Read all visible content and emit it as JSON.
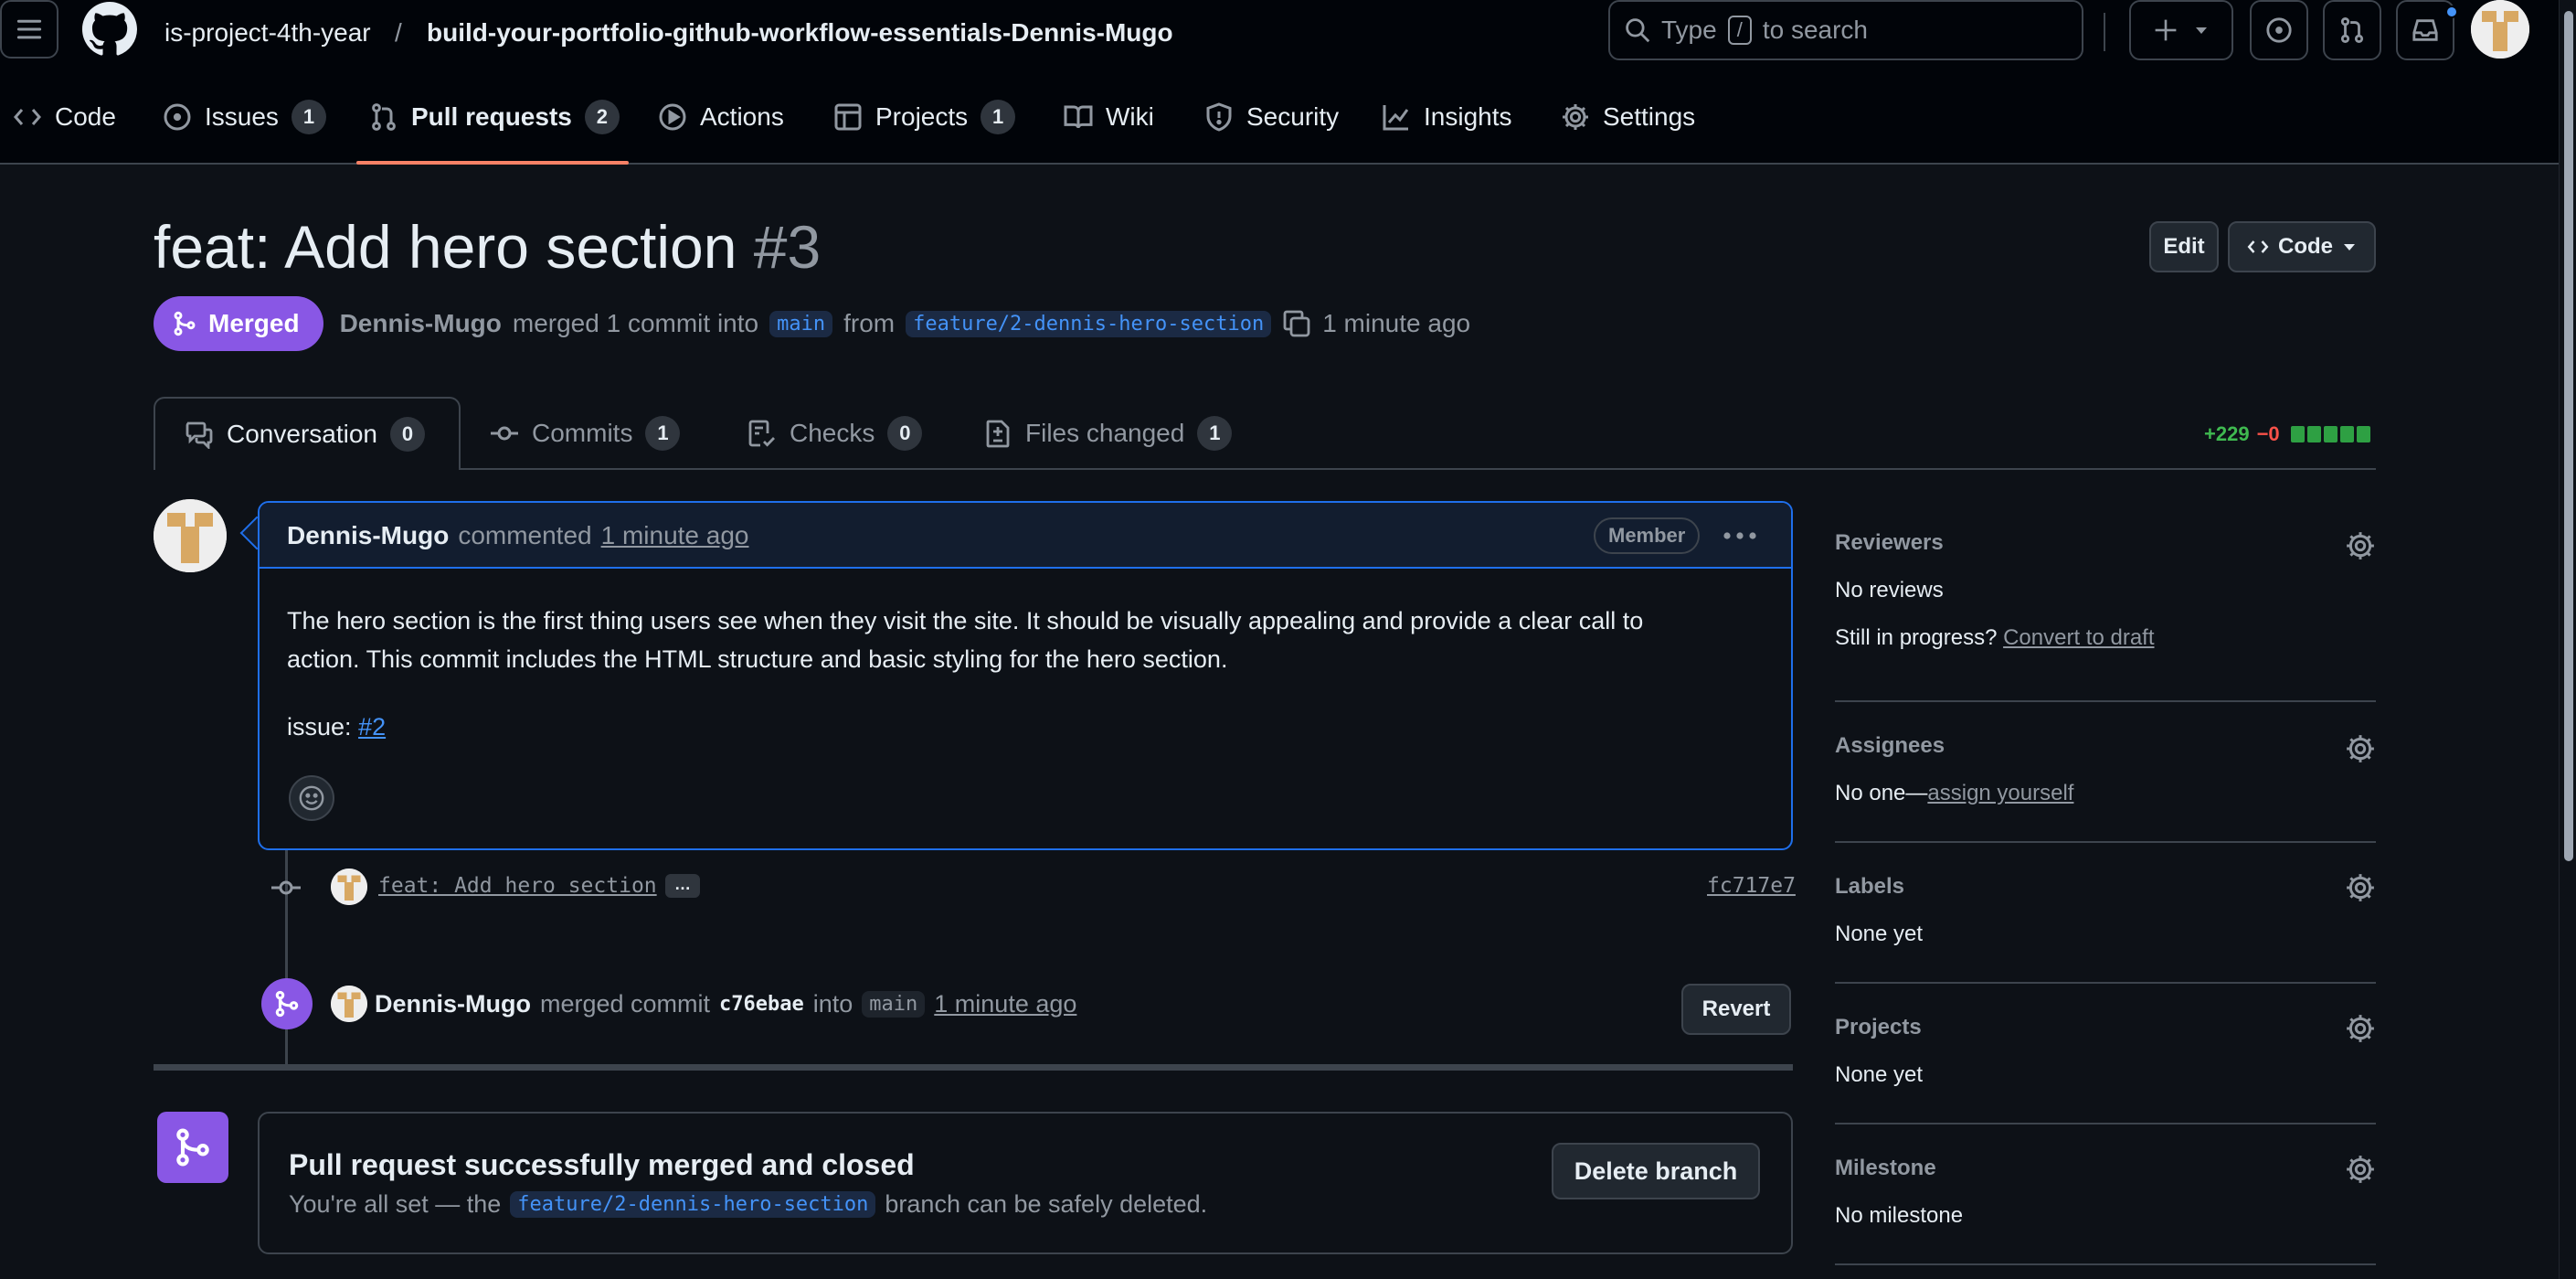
{
  "header": {
    "owner": "is-project-4th-year",
    "separator": "/",
    "repo": "build-your-portfolio-github-workflow-essentials-Dennis-Mugo",
    "search": {
      "prefix": "Type",
      "key": "/",
      "suffix": "to search"
    }
  },
  "repo_nav": {
    "items": [
      {
        "label": "Code"
      },
      {
        "label": "Issues",
        "count": "1"
      },
      {
        "label": "Pull requests",
        "count": "2"
      },
      {
        "label": "Actions"
      },
      {
        "label": "Projects",
        "count": "1"
      },
      {
        "label": "Wiki"
      },
      {
        "label": "Security"
      },
      {
        "label": "Insights"
      },
      {
        "label": "Settings"
      }
    ]
  },
  "pr": {
    "title": "feat: Add hero section",
    "number": "#3",
    "edit_label": "Edit",
    "code_label": "Code",
    "state": "Merged",
    "author": "Dennis-Mugo",
    "merged_text": "merged 1 commit into",
    "base_branch": "main",
    "from_text": "from",
    "head_branch": "feature/2-dennis-hero-section",
    "time": "1 minute ago"
  },
  "tabs": [
    {
      "label": "Conversation",
      "count": "0"
    },
    {
      "label": "Commits",
      "count": "1"
    },
    {
      "label": "Checks",
      "count": "0"
    },
    {
      "label": "Files changed",
      "count": "1"
    }
  ],
  "diffstat": {
    "additions": "+229",
    "deletions": "−0"
  },
  "comment": {
    "author": "Dennis-Mugo",
    "action": "commented",
    "time": "1 minute ago",
    "role": "Member",
    "body_line1": "The hero section is the first thing users see when they visit the site. It should be visually appealing and provide a clear call to",
    "body_line2": "action. This commit includes the HTML structure and basic styling for the hero section.",
    "issue_label": "issue:",
    "issue_ref": "#2"
  },
  "timeline": {
    "commit_message": "feat: Add hero section",
    "commit_ellipsis": "…",
    "commit_sha": "fc717e7",
    "merge_author": "Dennis-Mugo",
    "merge_text": "merged commit",
    "merge_sha": "c76ebae",
    "into_text": "into",
    "merge_branch": "main",
    "merge_time": "1 minute ago",
    "revert_label": "Revert"
  },
  "merged_box": {
    "title": "Pull request successfully merged and closed",
    "text_before": "You're all set — the",
    "branch": "feature/2-dennis-hero-section",
    "text_after": "branch can be safely deleted.",
    "delete_label": "Delete branch"
  },
  "sidebar": {
    "reviewers": {
      "title": "Reviewers",
      "value": "No reviews",
      "draft_prefix": "Still in progress?",
      "draft_link": "Convert to draft"
    },
    "assignees": {
      "title": "Assignees",
      "value_prefix": "No one—",
      "value_link": "assign yourself"
    },
    "labels": {
      "title": "Labels",
      "value": "None yet"
    },
    "projects": {
      "title": "Projects",
      "value": "None yet"
    },
    "milestone": {
      "title": "Milestone",
      "value": "No milestone"
    }
  },
  "colors": {
    "merged_purple": "#8957e5",
    "accent_blue": "#4493f8",
    "add_green": "#3fb950",
    "del_red": "#f85149",
    "nav_underline": "#f78166"
  }
}
